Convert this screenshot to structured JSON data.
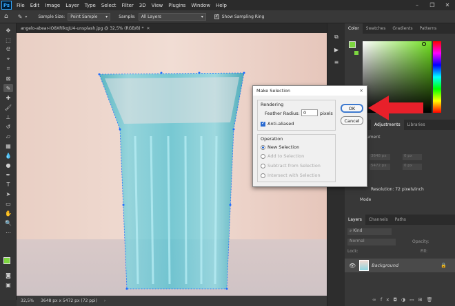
{
  "menubar": {
    "logo": "Ps",
    "items": [
      "File",
      "Edit",
      "Image",
      "Layer",
      "Type",
      "Select",
      "Filter",
      "3D",
      "View",
      "Plugins",
      "Window",
      "Help"
    ]
  },
  "options": {
    "sample_size_label": "Sample Size:",
    "sample_size_value": "Point Sample",
    "sample_label": "Sample:",
    "sample_value": "All Layers",
    "show_ring_label": "Show Sampling Ring"
  },
  "document": {
    "tab_title": "angelo-abear-IO8XRlkqJU4-unsplash.jpg @ 32,5% (RGB/8) *",
    "zoom": "32,5%",
    "size_info": "3648 px x 5472 px (72 ppi)"
  },
  "dialog": {
    "title": "Make Selection",
    "rendering_label": "Rendering",
    "feather_label": "Feather Radius:",
    "feather_value": "0",
    "feather_unit": "pixels",
    "antialiased_label": "Anti-aliased",
    "operation_label": "Operation",
    "op_new": "New Selection",
    "op_add": "Add to Selection",
    "op_subtract": "Subtract from Selection",
    "op_intersect": "Intersect with Selection",
    "ok": "OK",
    "cancel": "Cancel"
  },
  "panels": {
    "color_tabs": [
      "Color",
      "Swatches",
      "Gradients",
      "Patterns"
    ],
    "props_tabs": [
      "Adjustments",
      "Libraries"
    ],
    "props_partial_label": "ument",
    "props_w": "3648 px",
    "props_h": "5472 px",
    "props_x": "0 px",
    "props_y": "0 px",
    "resolution": "Resolution: 72 pixels/inch",
    "mode": "Mode",
    "layers_tabs": [
      "Layers",
      "Channels",
      "Paths"
    ],
    "kind": "Kind",
    "blend_mode": "Normal",
    "opacity_label": "Opacity:",
    "fill_label": "Fill:",
    "lock_label": "Lock:",
    "layer_name": "Background"
  },
  "colors": {
    "accent_arrow": "#e8202a",
    "foreground": "#7dd640",
    "selection_cyan": "#3fb8c8"
  }
}
